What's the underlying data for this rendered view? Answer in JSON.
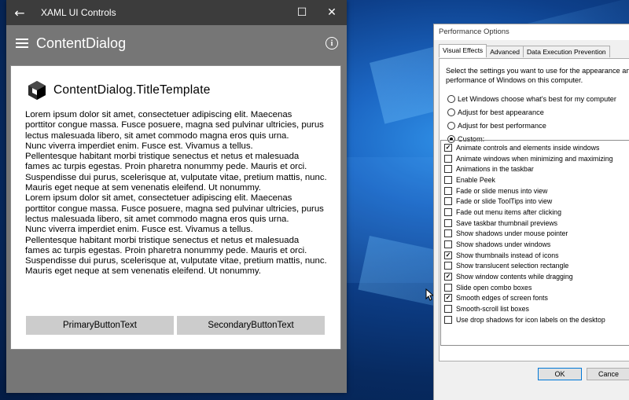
{
  "window": {
    "title": "XAML UI Controls",
    "back_glyph": "←",
    "maximize_glyph": "☐",
    "close_glyph": "✕"
  },
  "appbar": {
    "title": "ContentDialog",
    "info_glyph": "i"
  },
  "dialog": {
    "title": "ContentDialog.TitleTemplate",
    "body_lines": [
      "Lorem ipsum dolor sit amet, consectetuer adipiscing elit. Maecenas",
      "porttitor congue massa. Fusce posuere, magna sed pulvinar ultricies, purus",
      "lectus malesuada libero, sit amet commodo magna eros quis urna.",
      "Nunc viverra imperdiet enim. Fusce est. Vivamus a tellus.",
      "Pellentesque habitant morbi tristique senectus et netus et malesuada",
      "fames ac turpis egestas. Proin pharetra nonummy pede. Mauris et orci.",
      "Suspendisse dui purus, scelerisque at, vulputate vitae, pretium mattis, nunc.",
      "Mauris eget neque at sem venenatis eleifend. Ut nonummy.",
      "Lorem ipsum dolor sit amet, consectetuer adipiscing elit. Maecenas",
      "porttitor congue massa. Fusce posuere, magna sed pulvinar ultricies, purus",
      "lectus malesuada libero, sit amet commodo magna eros quis urna.",
      "Nunc viverra imperdiet enim. Fusce est. Vivamus a tellus.",
      "Pellentesque habitant morbi tristique senectus et netus et malesuada",
      "fames ac turpis egestas. Proin pharetra nonummy pede. Mauris et orci.",
      "Suspendisse dui purus, scelerisque at, vulputate vitae, pretium mattis, nunc.",
      "Mauris eget neque at sem venenatis eleifend. Ut nonummy."
    ],
    "primary_button": "PrimaryButtonText",
    "secondary_button": "SecondaryButtonText"
  },
  "performance": {
    "title": "Performance Options",
    "tabs": [
      "Visual Effects",
      "Advanced",
      "Data Execution Prevention"
    ],
    "description": "Select the settings you want to use for the appearance and performance of Windows on this computer.",
    "radios": [
      {
        "label": "Let Windows choose what's best for my computer",
        "selected": false
      },
      {
        "label": "Adjust for best appearance",
        "selected": false
      },
      {
        "label": "Adjust for best performance",
        "selected": false
      },
      {
        "label": "Custom:",
        "selected": true
      }
    ],
    "options": [
      {
        "label": "Animate controls and elements inside windows",
        "checked": true
      },
      {
        "label": "Animate windows when minimizing and maximizing",
        "checked": false
      },
      {
        "label": "Animations in the taskbar",
        "checked": false
      },
      {
        "label": "Enable Peek",
        "checked": false
      },
      {
        "label": "Fade or slide menus into view",
        "checked": false
      },
      {
        "label": "Fade or slide ToolTips into view",
        "checked": false
      },
      {
        "label": "Fade out menu items after clicking",
        "checked": false
      },
      {
        "label": "Save taskbar thumbnail previews",
        "checked": false
      },
      {
        "label": "Show shadows under mouse pointer",
        "checked": false
      },
      {
        "label": "Show shadows under windows",
        "checked": false
      },
      {
        "label": "Show thumbnails instead of icons",
        "checked": true
      },
      {
        "label": "Show translucent selection rectangle",
        "checked": false
      },
      {
        "label": "Show window contents while dragging",
        "checked": true
      },
      {
        "label": "Slide open combo boxes",
        "checked": false
      },
      {
        "label": "Smooth edges of screen fonts",
        "checked": true
      },
      {
        "label": "Smooth-scroll list boxes",
        "checked": false
      },
      {
        "label": "Use drop shadows for icon labels on the desktop",
        "checked": false
      }
    ],
    "ok_button": "OK",
    "cancel_button": "Cance"
  }
}
